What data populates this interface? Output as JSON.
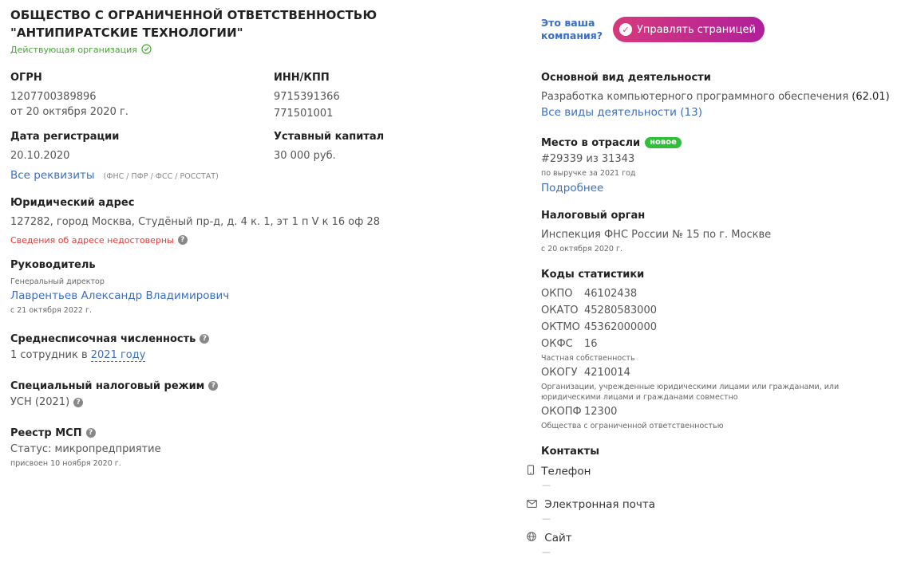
{
  "company": {
    "name": "ОБЩЕСТВО С ОГРАНИЧЕННОЙ ОТВЕТСТВЕННОСТЬЮ \"АНТИПИРАТСКИЕ ТЕХНОЛОГИИ\"",
    "status": "Действующая организация"
  },
  "claim": {
    "question_line1": "Это ваша",
    "question_line2": "компания?",
    "button_label": "Управлять страницей"
  },
  "ogrn": {
    "label": "ОГРН",
    "value": "1207700389896",
    "date": "от 20 октября 2020 г."
  },
  "inn_kpp": {
    "label": "ИНН/КПП",
    "inn": "9715391366",
    "kpp": "771501001"
  },
  "registration": {
    "label": "Дата регистрации",
    "value": "20.10.2020",
    "all_details_link": "Все реквизиты",
    "details_note": "(ФНС / ПФР / ФСС / РОССТАТ)"
  },
  "capital": {
    "label": "Уставный капитал",
    "value": "30 000 руб."
  },
  "address": {
    "label": "Юридический адрес",
    "value": "127282, город Москва, Студёный пр-д, д. 4 к. 1, эт 1 п V к 16 оф 28",
    "warning": "Сведения об адресе недостоверны"
  },
  "head": {
    "label": "Руководитель",
    "position": "Генеральный директор",
    "name": "Лаврентьев Александр Владимирович",
    "since": "с 21 октября 2022 г."
  },
  "headcount": {
    "label": "Среднесписочная численность",
    "prefix": "1 сотрудник в",
    "year_link": "2021 году"
  },
  "tax_regime": {
    "label": "Специальный налоговый режим",
    "value": "УСН (2021)"
  },
  "msp": {
    "label": "Реестр МСП",
    "status": "Статус: микропредприятие",
    "since": "присвоен 10 ноября 2020 г."
  },
  "activity": {
    "label": "Основной вид деятельности",
    "value": "Разработка компьютерного программного обеспечения",
    "code": "(62.01)",
    "all_link": "Все виды деятельности (13)"
  },
  "rank": {
    "label": "Место в отрасли",
    "badge": "новое",
    "value": "#29339 из 31343",
    "note": "по выручке за 2021 год",
    "more_link": "Подробнее"
  },
  "tax_office": {
    "label": "Налоговый орган",
    "value": "Инспекция ФНС России № 15 по г. Москве",
    "since": "с 20 октября 2020 г."
  },
  "stats": {
    "label": "Коды статистики",
    "okpo_k": "ОКПО",
    "okpo_v": "46102438",
    "okato_k": "ОКАТО",
    "okato_v": "45280583000",
    "oktmo_k": "ОКТМО",
    "oktmo_v": "45362000000",
    "okfs_k": "ОКФС",
    "okfs_v": "16",
    "okfs_note": "Частная собственность",
    "okogu_k": "ОКОГУ",
    "okogu_v": "4210014",
    "okogu_note1": "Организации, учрежденные юридическими лицами или гражданами, или",
    "okogu_note2": "юридическими лицами и гражданами совместно",
    "okopf_k": "ОКОПФ",
    "okopf_v": "12300",
    "okopf_note": "Общества с ограниченной ответственностью"
  },
  "contacts": {
    "label": "Контакты",
    "phone_label": "Телефон",
    "phone_value": "—",
    "email_label": "Электронная почта",
    "email_value": "—",
    "site_label": "Сайт",
    "site_value": "—"
  },
  "colors": {
    "link": "#3a6fc2",
    "ok": "#4aa33b",
    "warning": "#e53935",
    "button_from": "#d63a7c",
    "button_to": "#b01f9b",
    "badge": "#2fbf3a"
  }
}
